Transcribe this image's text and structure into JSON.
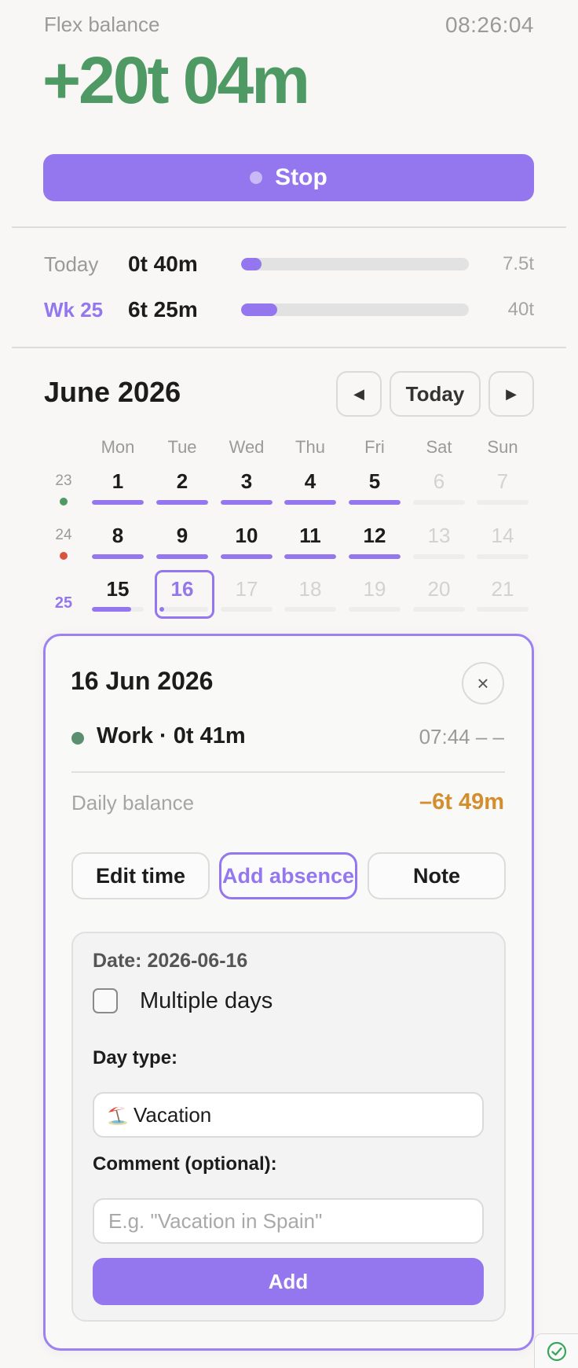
{
  "header": {
    "flex_label": "Flex balance",
    "clock": "08:26:04",
    "flex_value": "+20t 04m",
    "stop_label": "Stop"
  },
  "progress": {
    "today": {
      "label": "Today",
      "value": "0t 40m",
      "target": "7.5t",
      "fraction": 0.09
    },
    "week": {
      "label": "Wk 25",
      "value": "6t 25m",
      "target": "40t",
      "fraction": 0.16
    }
  },
  "calendar": {
    "month_title": "June 2026",
    "prev_icon": "◀",
    "today_label": "Today",
    "next_icon": "▶",
    "weekdays": [
      "Mon",
      "Tue",
      "Wed",
      "Thu",
      "Fri",
      "Sat",
      "Sun"
    ],
    "weeks": [
      {
        "number": "23",
        "status_color": "#4f9a64",
        "current": false,
        "days": [
          {
            "label": "1",
            "dim": false,
            "fill": 1
          },
          {
            "label": "2",
            "dim": false,
            "fill": 1
          },
          {
            "label": "3",
            "dim": false,
            "fill": 1
          },
          {
            "label": "4",
            "dim": false,
            "fill": 1
          },
          {
            "label": "5",
            "dim": false,
            "fill": 1
          },
          {
            "label": "6",
            "dim": true,
            "fill": 0
          },
          {
            "label": "7",
            "dim": true,
            "fill": 0
          }
        ]
      },
      {
        "number": "24",
        "status_color": "#d9533f",
        "current": false,
        "days": [
          {
            "label": "8",
            "dim": false,
            "fill": 1
          },
          {
            "label": "9",
            "dim": false,
            "fill": 1
          },
          {
            "label": "10",
            "dim": false,
            "fill": 1
          },
          {
            "label": "11",
            "dim": false,
            "fill": 1
          },
          {
            "label": "12",
            "dim": false,
            "fill": 1
          },
          {
            "label": "13",
            "dim": true,
            "fill": 0
          },
          {
            "label": "14",
            "dim": true,
            "fill": 0
          }
        ]
      },
      {
        "number": "25",
        "status_color": "",
        "current": true,
        "days": [
          {
            "label": "15",
            "dim": false,
            "fill": 0.75
          },
          {
            "label": "16",
            "dim": false,
            "fill": 0.09,
            "selected": true
          },
          {
            "label": "17",
            "dim": true,
            "fill": 0
          },
          {
            "label": "18",
            "dim": true,
            "fill": 0
          },
          {
            "label": "19",
            "dim": true,
            "fill": 0
          },
          {
            "label": "20",
            "dim": true,
            "fill": 0
          },
          {
            "label": "21",
            "dim": true,
            "fill": 0
          }
        ]
      }
    ]
  },
  "detail": {
    "date": "16 Jun 2026",
    "close_icon": "×",
    "work_label": "Work · 0t 41m",
    "work_time": "07:44 – –",
    "balance_label": "Daily balance",
    "balance_value": "–6t 49m",
    "balance_color": "#d48e2e",
    "actions": {
      "edit": "Edit time",
      "absence": "Add absence",
      "note": "Note"
    },
    "form": {
      "date_line": "Date: 2026-06-16",
      "multiple_days_label": "Multiple days",
      "day_type_label": "Day type:",
      "day_type_icon": "beach-umbrella-icon",
      "day_type_value": "Vacation",
      "comment_label": "Comment (optional):",
      "comment_placeholder": "E.g. \"Vacation in Spain\"",
      "add_label": "Add"
    }
  },
  "colors": {
    "accent": "#9477ee",
    "positive": "#4f9a64",
    "warning": "#d48e2e"
  }
}
